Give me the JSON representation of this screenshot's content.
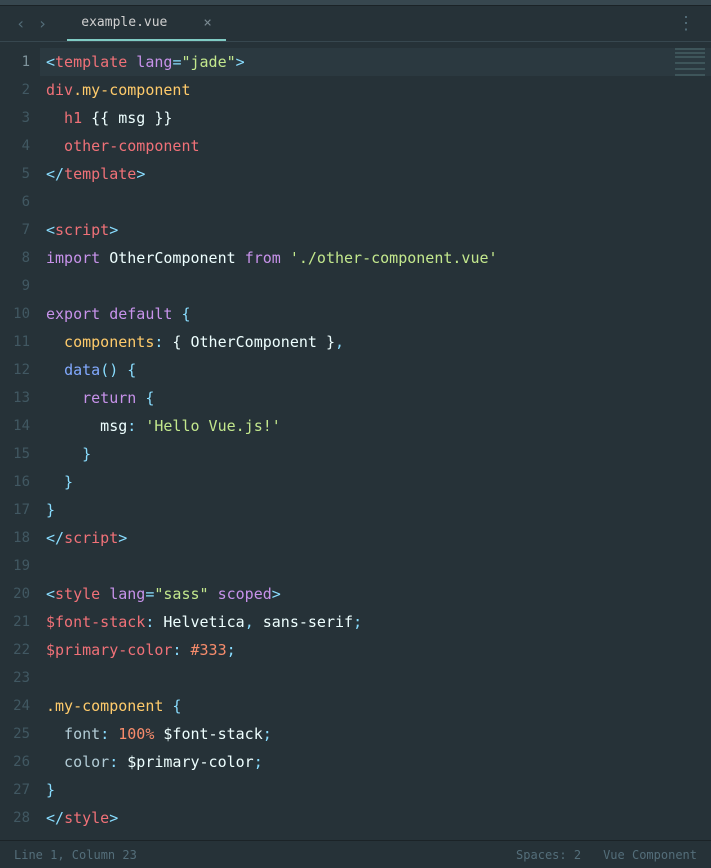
{
  "tab": {
    "filename": "example.vue"
  },
  "status": {
    "cursor": "Line 1, Column 23",
    "spaces": "Spaces: 2",
    "syntax": "Vue Component"
  },
  "code": {
    "l1": {
      "a": "<",
      "b": "template",
      "c": " lang",
      "d": "=",
      "e": "\"jade\"",
      "f": ">"
    },
    "l2": {
      "a": "div",
      "b": ".my-component"
    },
    "l3": {
      "a": "  h1",
      "b": " {{ msg }}"
    },
    "l4": {
      "a": "  other-component"
    },
    "l5": {
      "a": "</",
      "b": "template",
      "c": ">"
    },
    "l7": {
      "a": "<",
      "b": "script",
      "c": ">"
    },
    "l8": {
      "a": "import",
      "b": " OtherComponent ",
      "c": "from",
      "d": " ",
      "e": "'./other-component.vue'"
    },
    "l10": {
      "a": "export",
      "b": " ",
      "c": "default",
      "d": " {"
    },
    "l11": {
      "a": "  components",
      "b": ":",
      "c": " { OtherComponent }",
      "d": ","
    },
    "l12": {
      "a": "  ",
      "b": "data",
      "c": "() {"
    },
    "l13": {
      "a": "    ",
      "b": "return",
      "c": " {"
    },
    "l14": {
      "a": "      msg",
      "b": ":",
      "c": " ",
      "d": "'Hello Vue.js!'"
    },
    "l15": {
      "a": "    }"
    },
    "l16": {
      "a": "  }"
    },
    "l17": {
      "a": "}"
    },
    "l18": {
      "a": "</",
      "b": "script",
      "c": ">"
    },
    "l20": {
      "a": "<",
      "b": "style",
      "c": " lang",
      "d": "=",
      "e": "\"sass\"",
      "f": " scoped",
      "g": ">"
    },
    "l21": {
      "a": "$font-stack",
      "b": ":",
      "c": " Helvetica",
      "d": ",",
      "e": " sans-serif",
      "f": ";"
    },
    "l22": {
      "a": "$primary-color",
      "b": ":",
      "c": " ",
      "d": "#333",
      "e": ";"
    },
    "l24": {
      "a": ".my-component",
      "b": " {"
    },
    "l25": {
      "a": "  font",
      "b": ":",
      "c": " ",
      "d": "100%",
      "e": " $font-stack",
      "f": ";"
    },
    "l26": {
      "a": "  color",
      "b": ":",
      "c": " $primary-color",
      "d": ";"
    },
    "l27": {
      "a": "}"
    },
    "l28": {
      "a": "</",
      "b": "style",
      "c": ">"
    }
  }
}
